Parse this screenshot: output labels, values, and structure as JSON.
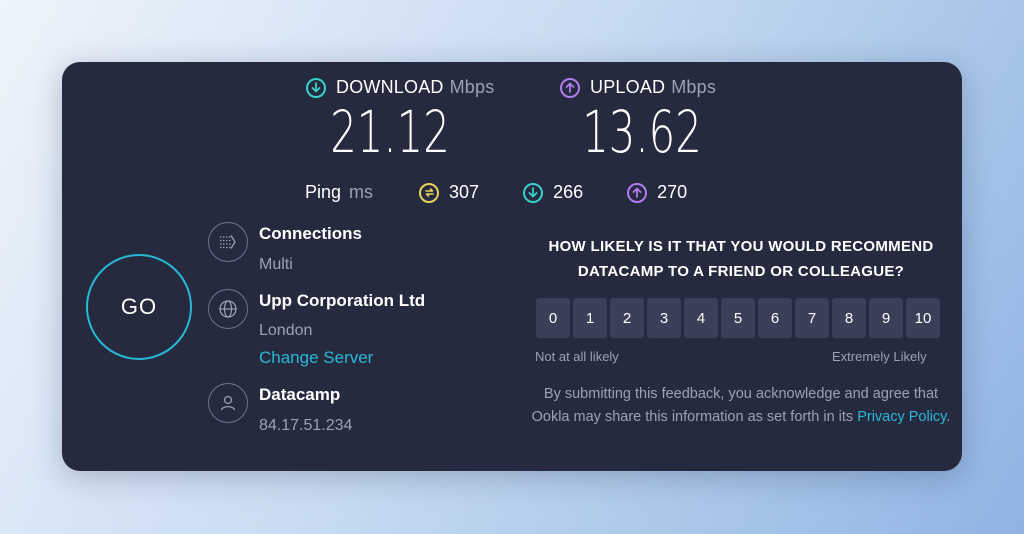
{
  "download": {
    "label": "DOWNLOAD",
    "unit": "Mbps",
    "value": "21.12"
  },
  "upload": {
    "label": "UPLOAD",
    "unit": "Mbps",
    "value": "13.62"
  },
  "ping": {
    "label": "Ping",
    "unit": "ms",
    "idle": "307",
    "download": "266",
    "upload": "270"
  },
  "go_button": {
    "label": "GO"
  },
  "connections": {
    "title": "Connections",
    "value": "Multi"
  },
  "server": {
    "title": "Upp Corporation Ltd",
    "location": "London",
    "change_label": "Change Server"
  },
  "provider": {
    "title": "Datacamp",
    "ip": "84.17.51.234"
  },
  "survey": {
    "question_line1": "HOW LIKELY IS IT THAT YOU WOULD RECOMMEND",
    "question_line2": "DATACAMP TO A FRIEND OR COLLEAGUE?",
    "scale": [
      "0",
      "1",
      "2",
      "3",
      "4",
      "5",
      "6",
      "7",
      "8",
      "9",
      "10"
    ],
    "low_label": "Not at all likely",
    "high_label": "Extremely Likely",
    "disclaimer_text": "By submitting this feedback, you acknowledge and agree that Ookla may share this information as set forth in its ",
    "privacy_link": "Privacy Policy",
    "disclaimer_end": "."
  },
  "colors": {
    "card_bg": "#262a3f",
    "accent_cyan": "#28b8d6",
    "download_icon": "#3ad0c8",
    "upload_icon": "#b07cf0",
    "ping_idle_icon": "#e8d35a",
    "muted_text": "#9da1b7"
  }
}
